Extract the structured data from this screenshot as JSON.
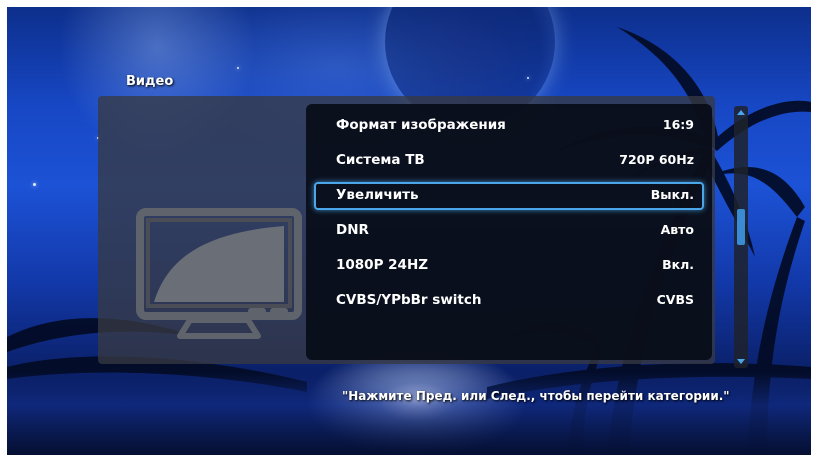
{
  "screen": {
    "title": "Видео"
  },
  "menu": {
    "items": [
      {
        "label": "Формат изображения",
        "value": "16:9"
      },
      {
        "label": "Система ТВ",
        "value": "720P 60Hz"
      },
      {
        "label": "Увеличить",
        "value": "Выкл.",
        "selected": true
      },
      {
        "label": "DNR",
        "value": "Авто"
      },
      {
        "label": "1080P 24HZ",
        "value": "Вкл."
      },
      {
        "label": "CVBS/YPbBr switch",
        "value": "CVBS"
      }
    ]
  },
  "preview": {
    "icon": "tv-icon"
  },
  "scroll": {
    "position": 0.45
  },
  "hint": "\"Нажмите Пред. или След., чтобы перейти категории.\"",
  "colors": {
    "accent": "#4aa6e8",
    "panel": "#373a42",
    "list_bg": "#080c18"
  }
}
